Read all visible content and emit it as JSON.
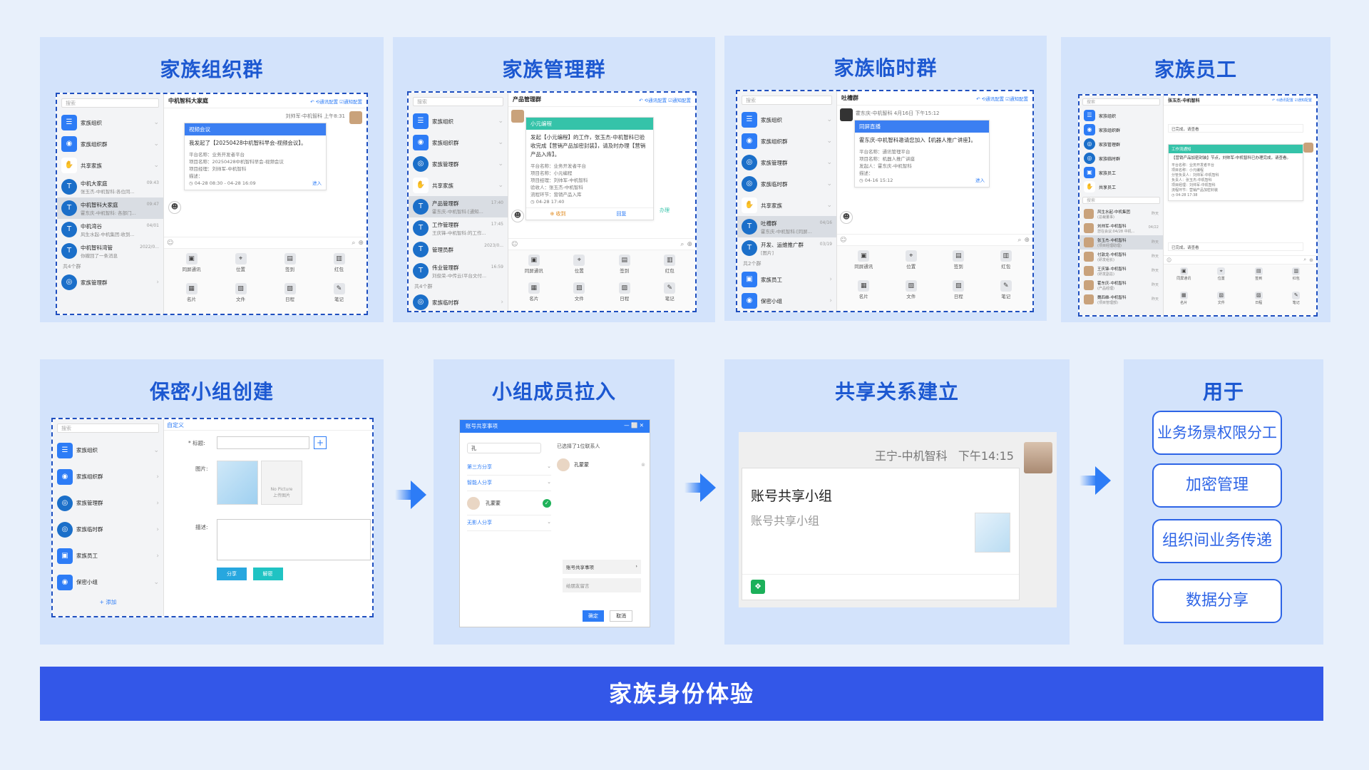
{
  "panels": {
    "org": {
      "title": "家族组织群"
    },
    "mgmt": {
      "title": "家族管理群"
    },
    "temp": {
      "title": "家族临时群"
    },
    "staff": {
      "title": "家族员工"
    },
    "secret": {
      "title": "保密小组创建"
    },
    "members": {
      "title": "小组成员拉入"
    },
    "share": {
      "title": "共享关系建立"
    },
    "usage": {
      "title": "用于"
    }
  },
  "common": {
    "search": "搜索",
    "tools": [
      "同屏通讯",
      "位置",
      "签到",
      "红包",
      "名片",
      "文件",
      "日程",
      "笔记"
    ]
  },
  "org_shot": {
    "chat_title": "中机智科大家庭",
    "header_actions": "↶ ⟲通讯配置 ☑通知配置",
    "sender": "刘帅军-中机智科  上午8:31",
    "card_header": "视频会议",
    "card_body": "我发起了【20250428中机智科早会-视频会议】。",
    "meta": [
      "平台名称：业务开发者平台",
      "项目名称：20250428中机智科早会-视频会议",
      "项目经理：刘帅军-中机智科",
      "描述：",
      "◷ 04-28 08:30 - 04-28 16:09"
    ],
    "enter": "进入",
    "items": [
      {
        "name": "家族组织",
        "sub": "",
        "time": ""
      },
      {
        "name": "家族组织群",
        "sub": "",
        "time": ""
      },
      {
        "name": "共享家族",
        "sub": "",
        "time": ""
      },
      {
        "name": "中机大家庭",
        "sub": "张玉杰-中机智科:各位同...",
        "time": "09:43"
      },
      {
        "name": "中机智科大家庭",
        "sub": "霍东庆-中机智科: 各部门...",
        "time": "09:47"
      },
      {
        "name": "中机湾谷",
        "sub": "风生水起-中机集团:收到...",
        "time": "04/01"
      },
      {
        "name": "中机智科湾管",
        "sub": "你撤回了一条消息",
        "time": "2022/0..."
      },
      {
        "name": "家族管理群",
        "sub": "",
        "time": ""
      }
    ],
    "group_count": "共4个群"
  },
  "mgmt_shot": {
    "chat_title": "产品管理群",
    "header_actions": "↶ ⟲通讯配置 ☑通知配置",
    "card_header": "小元编程",
    "card_body": "发起【小元编程】的工作，张玉杰-中机智科已验收完成【营销产品加密封装】，请及时办理【营销产品入库】。",
    "meta": [
      "平台名称：业务开发者平台",
      "项目名称：小元编程",
      "项目经理：刘帅军-中机智科",
      "验收人：张玉杰-中机智科",
      "流程环节：营销产品入库",
      "◷ 04-28 17:40"
    ],
    "actions": [
      "⊕ 收到",
      "回复"
    ],
    "handle": "办理",
    "items": [
      {
        "name": "家族组织",
        "sub": "",
        "time": ""
      },
      {
        "name": "家族组织群",
        "sub": "",
        "time": ""
      },
      {
        "name": "家族管理群",
        "sub": "",
        "time": ""
      },
      {
        "name": "共享家族",
        "sub": "",
        "time": ""
      },
      {
        "name": "产品管理群",
        "sub": "霍东庆-中机智科:[通知...",
        "time": "17:40"
      },
      {
        "name": "工作管理群",
        "sub": "王庆锋-中机智科:的工作...",
        "time": "17:45"
      },
      {
        "name": "管理员群",
        "sub": "",
        "time": "2023/0..."
      },
      {
        "name": "伟业管理群",
        "sub": "刘俊荣-中传云(平台文付...",
        "time": "16:59"
      },
      {
        "name": "家族临时群",
        "sub": "",
        "time": ""
      }
    ],
    "group_count": "共4个群"
  },
  "temp_shot": {
    "chat_title": "吐槽群",
    "header_actions": "↶ ⟲通讯配置 ☑通知配置",
    "sender": "霍东庆-中机智科  4月16日 下午15:12",
    "card_header": "同屏直播",
    "card_body": "霍东庆-中机智科邀请您加入【机器人推广讲座】。",
    "meta": [
      "平台名称：通讯管理平台",
      "项目名称：机器人推广讲座",
      "发起人：霍东庆-中机智科",
      "描述：",
      "◷ 04-16 15:12"
    ],
    "enter": "进入",
    "items": [
      {
        "name": "家族组织",
        "sub": "",
        "time": ""
      },
      {
        "name": "家族组织群",
        "sub": "",
        "time": ""
      },
      {
        "name": "家族管理群",
        "sub": "",
        "time": ""
      },
      {
        "name": "家族临时群",
        "sub": "",
        "time": ""
      },
      {
        "name": "共享家族",
        "sub": "",
        "time": ""
      },
      {
        "name": "吐槽群",
        "sub": "霍东庆-中机智科:[同屏...",
        "time": "04/16"
      },
      {
        "name": "开发、运维推广群",
        "sub": "[图片]",
        "time": "03/19"
      },
      {
        "name": "家族员工",
        "sub": "",
        "time": ""
      },
      {
        "name": "保密小组",
        "sub": "",
        "time": ""
      }
    ],
    "group_count": "共2个群"
  },
  "staff_shot": {
    "chat_title": "张玉杰-中机智科",
    "header_actions": "↶ ⟲通讯配置 ☑通知配置",
    "msg1": "已完成，请查看",
    "card_header": "工作流通知",
    "card_body": "【营销产品加密封装】节点，刘帅军-中机智科已办理完成，请查看。",
    "meta": [
      "平台名称：业务开发者平台",
      "项目名称：小元编程",
      "分管负责人：刘帅军-中机智科",
      "负责人：张玉杰-中机智科",
      "项目经理：刘帅军-中机智科",
      "流程环节：营销产品加密封装",
      "◷ 04-28 17:38"
    ],
    "msg2": "已完成，请查看",
    "items": [
      {
        "name": "家族组织",
        "sub": "",
        "time": ""
      },
      {
        "name": "家族组织群",
        "sub": "",
        "time": ""
      },
      {
        "name": "家族管理群",
        "sub": "",
        "time": ""
      },
      {
        "name": "家族临时群",
        "sub": "",
        "time": ""
      },
      {
        "name": "家族员工",
        "sub": "",
        "time": ""
      },
      {
        "name": "共享员工",
        "sub": "",
        "time": ""
      }
    ],
    "contacts": [
      {
        "name": "风生水起-中机集团",
        "sub": "(总裁董事)",
        "time": "昨天"
      },
      {
        "name": "刘帅军-中机智科",
        "sub": "您在会议:04/28 中机...",
        "time": "04/22"
      },
      {
        "name": "张玉杰-中机智科",
        "sub": "(项目经理助理)",
        "time": "昨天"
      },
      {
        "name": "付敦龙-中机智科",
        "sub": "(研发组长)",
        "time": "昨天"
      },
      {
        "name": "王庆锋-中机智科",
        "sub": "(研发副总)",
        "time": "昨天"
      },
      {
        "name": "霍东庆-中机智科",
        "sub": "(产品经理)",
        "time": "昨天"
      },
      {
        "name": "魏四维-中机智科",
        "sub": "(项目管理部)",
        "time": "昨天"
      }
    ]
  },
  "secret_shot": {
    "tab": "自定义",
    "title_label": "* 标题:",
    "image_label": "图片:",
    "desc_label": "描述:",
    "no_picture": "No Picture",
    "upload": "上传图片",
    "share_btn": "分享",
    "decrypt_btn": "解密",
    "add": "+ 添加",
    "items": [
      "家族组织",
      "家族组织群",
      "家族管理群",
      "家族临时群",
      "家族员工",
      "保密小组"
    ]
  },
  "members_shot": {
    "dialog_title": "账号共享事项",
    "search_value": "孔",
    "selected_text": "已选择了1位联系人",
    "selected_name": "孔蒙蒙",
    "categories": [
      "第三方分享",
      "智能人分享",
      "无影人分享"
    ],
    "person": "孔蒙蒙",
    "share_item": "账号共享事项",
    "leave_msg": "给朋友留言",
    "ok": "确定",
    "cancel": "取消"
  },
  "share_shot": {
    "sender": "王宁-中机智科",
    "time": "下午14:15",
    "card_title": "账号共享小组",
    "card_sub": "账号共享小组"
  },
  "usage": {
    "items": [
      "业务场景权限分工",
      "加密管理",
      "组织间业务传递",
      "数据分享"
    ]
  },
  "footer": "家族身份体验"
}
